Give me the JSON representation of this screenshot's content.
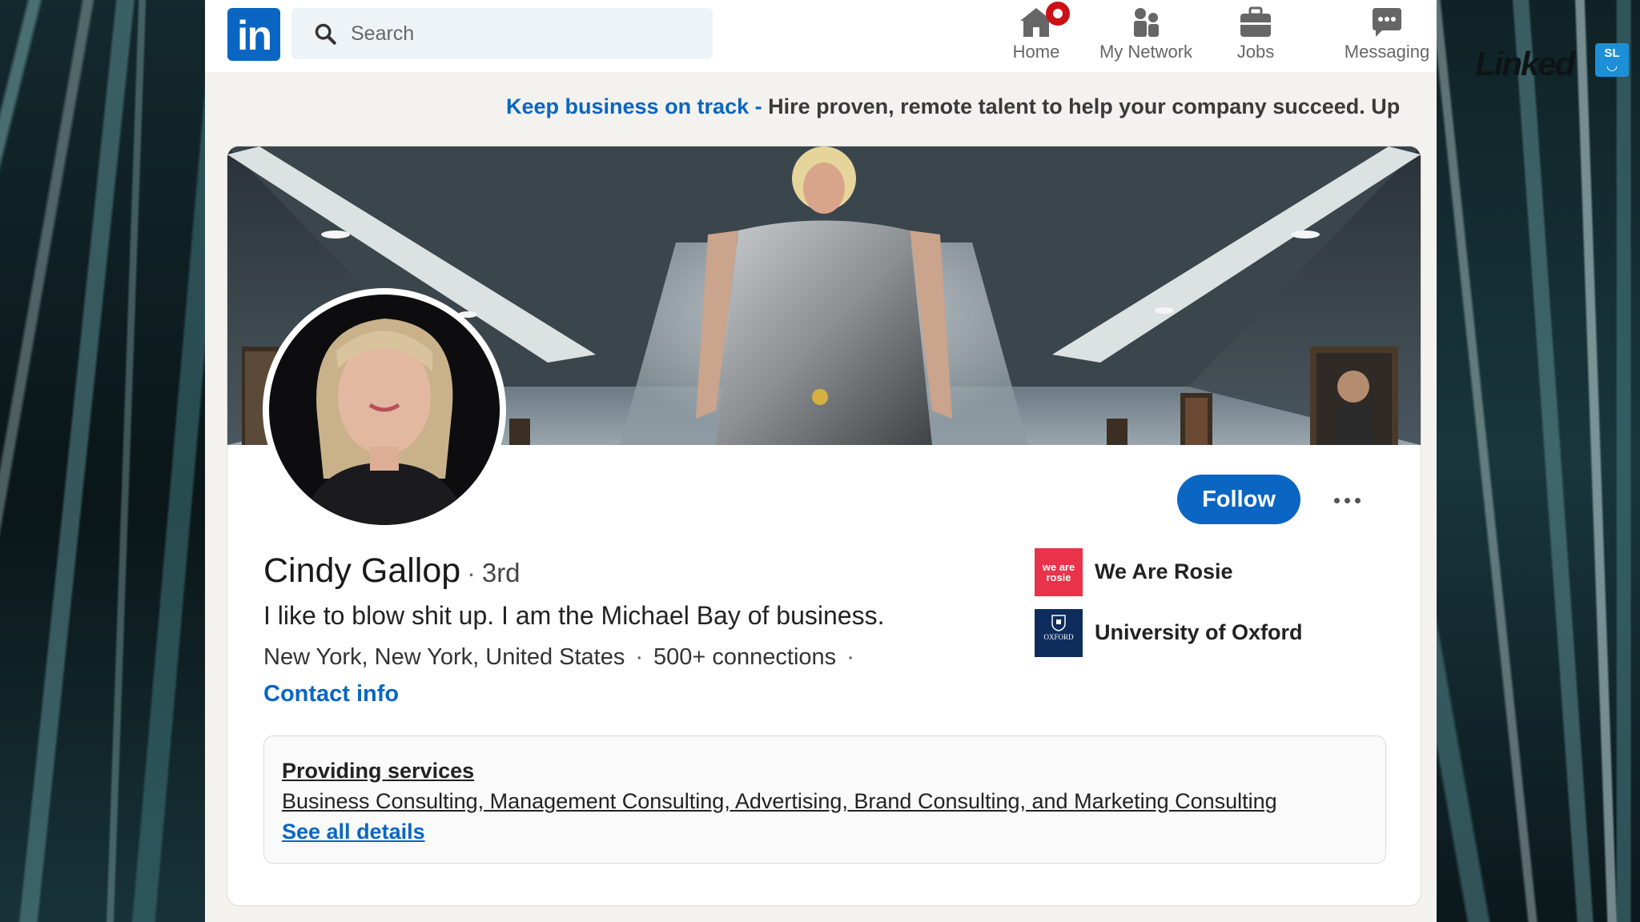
{
  "nav": {
    "search_placeholder": "Search",
    "items": [
      {
        "label": "Home",
        "icon": "home-icon",
        "badge": "notification-dot"
      },
      {
        "label": "My Network",
        "icon": "network-icon"
      },
      {
        "label": "Jobs",
        "icon": "briefcase-icon"
      },
      {
        "label": "Messaging",
        "icon": "message-icon"
      }
    ]
  },
  "brand": {
    "logo_text": "in",
    "corner_badge": "SL",
    "colors": {
      "primary": "#0a66c2",
      "notification": "#cc1016",
      "background": "#f3f2ef"
    }
  },
  "promo": {
    "link": "Keep business on track - ",
    "text": "Hire proven, remote talent to help your company succeed. Up"
  },
  "profile": {
    "name": "Cindy Gallop",
    "separator": "·",
    "degree": "3rd",
    "headline": "I like to blow shit up. I am the Michael Bay of business.",
    "location": "New York, New York, United States",
    "connections": "500+ connections",
    "contact_label": "Contact info",
    "follow_label": "Follow",
    "more_icon": "more-options-icon"
  },
  "organizations": [
    {
      "name": "We Are Rosie",
      "logo_text": "we are rosie",
      "color": "#e8334a"
    },
    {
      "name": "University of Oxford",
      "logo_text": "OXFORD",
      "color": "#0f2d5c"
    }
  ],
  "services": {
    "title": "Providing services",
    "list": "Business Consulting, Management Consulting, Advertising, Brand Consulting, and Marketing Consulting",
    "see_all": "See all details"
  }
}
